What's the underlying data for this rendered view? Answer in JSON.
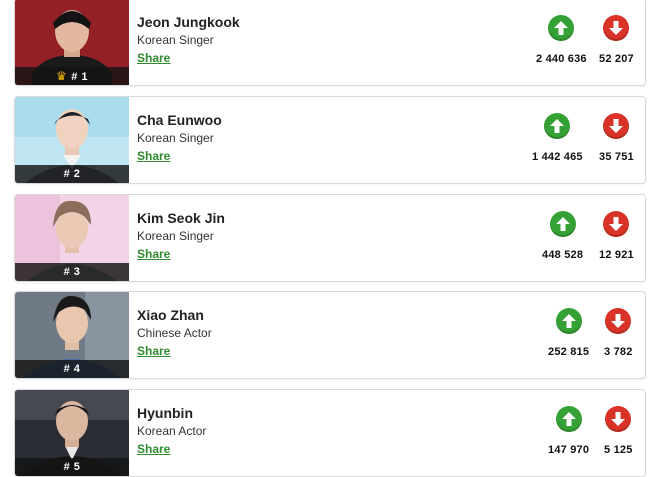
{
  "entries": [
    {
      "rank": "# 1",
      "name": "Jeon Jungkook",
      "role": "Korean Singer",
      "share_label": "Share",
      "up_count": "2 440 636",
      "down_count": "52 207",
      "crown_icon": "crown-icon"
    },
    {
      "rank": "# 2",
      "name": "Cha Eunwoo",
      "role": "Korean Singer",
      "share_label": "Share",
      "up_count": "1 442 465",
      "down_count": "35 751"
    },
    {
      "rank": "# 3",
      "name": "Kim Seok Jin",
      "role": "Korean Singer",
      "share_label": "Share",
      "up_count": "448 528",
      "down_count": "12 921"
    },
    {
      "rank": "# 4",
      "name": "Xiao Zhan",
      "role": "Chinese Actor",
      "share_label": "Share",
      "up_count": "252 815",
      "down_count": "3 782"
    },
    {
      "rank": "# 5",
      "name": "Hyunbin",
      "role": "Korean Actor",
      "share_label": "Share",
      "up_count": "147 970",
      "down_count": "5 125"
    }
  ],
  "colors": {
    "upvote": "#35a135",
    "downvote": "#d93327",
    "share_link": "#2f8c2f",
    "crown": "#f2b705"
  },
  "icons": {
    "upvote": "arrow-up-icon",
    "downvote": "arrow-down-icon"
  }
}
